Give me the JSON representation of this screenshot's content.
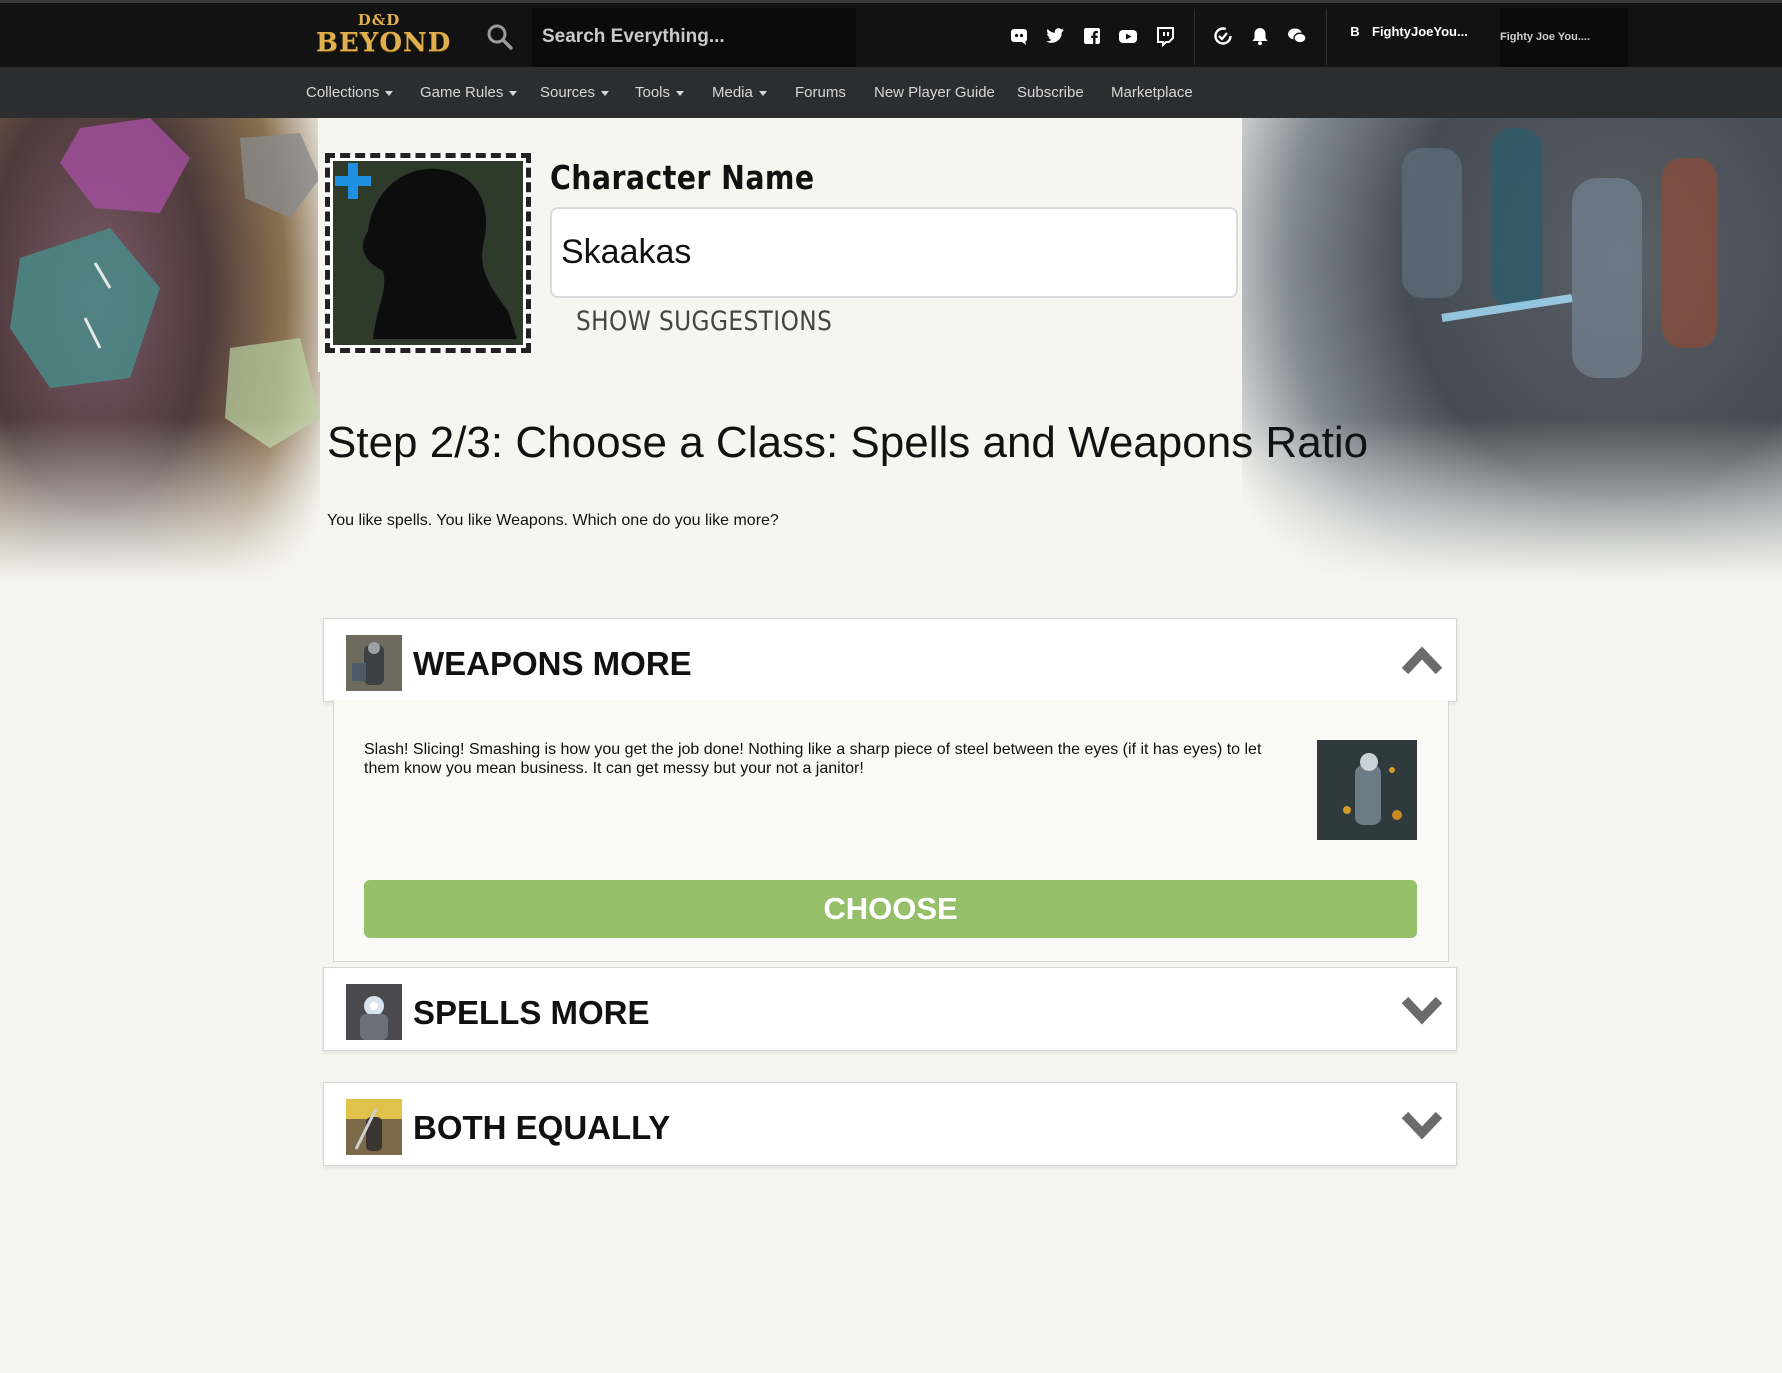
{
  "header": {
    "logo_top": "D&D",
    "logo_bottom": "BEYOND",
    "search_placeholder": "Search Everything...",
    "user_name": "FightyJoeYou...",
    "user_badge": "B",
    "user_name_2": "Fighty Joe You...."
  },
  "nav": {
    "items": [
      {
        "label": "Collections",
        "dropdown": true
      },
      {
        "label": "Game Rules",
        "dropdown": true
      },
      {
        "label": "Sources",
        "dropdown": true
      },
      {
        "label": "Tools",
        "dropdown": true
      },
      {
        "label": "Media",
        "dropdown": true
      },
      {
        "label": "Forums",
        "dropdown": false
      },
      {
        "label": "New Player Guide",
        "dropdown": false
      },
      {
        "label": "Subscribe",
        "dropdown": false
      },
      {
        "label": "Marketplace",
        "dropdown": false
      }
    ]
  },
  "character": {
    "label": "Character Name",
    "name_value": "Skaakas",
    "suggestions_label": "SHOW SUGGESTIONS"
  },
  "step": {
    "title": "Step 2/3: Choose a Class: Spells and Weapons Ratio",
    "description": "You like spells. You like Weapons. Which one do you like more?"
  },
  "options": [
    {
      "title": "WEAPONS MORE",
      "expanded": true,
      "description": "Slash! Slicing! Smashing is how you get the job done! Nothing like a sharp piece of steel between the eyes (if it has eyes) to let them know you mean business. It can get messy but your not a janitor!",
      "button_label": "CHOOSE"
    },
    {
      "title": "SPELLS MORE",
      "expanded": false
    },
    {
      "title": "BOTH EQUALLY",
      "expanded": false
    }
  ],
  "colors": {
    "choose_button": "#96bf6a",
    "plus_icon": "#1f8fe0",
    "logo_gold": "#e0b04c"
  },
  "icons": [
    "search-icon",
    "discord-icon",
    "twitter-icon",
    "facebook-icon",
    "youtube-icon",
    "twitch-icon",
    "sync-icon",
    "bell-icon",
    "chat-icon",
    "plus-icon",
    "chevron-up-icon",
    "chevron-down-icon"
  ]
}
